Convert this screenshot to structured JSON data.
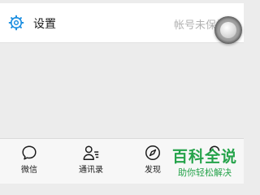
{
  "settings": {
    "label": "设置",
    "status_text": "帐号未保护"
  },
  "tabs": [
    {
      "label": "微信",
      "icon": "chat-bubble-icon"
    },
    {
      "label": "通讯录",
      "icon": "contacts-icon"
    },
    {
      "label": "发现",
      "icon": "compass-icon"
    },
    {
      "label": "",
      "icon": "me-icon"
    }
  ],
  "watermark": {
    "title": "百科全说",
    "subtitle": "助你轻松解决",
    "color": "#25a34a"
  },
  "colors": {
    "accent": "#1d8fe1",
    "background": "#ececec",
    "secondary_text": "#b2b2b2"
  }
}
